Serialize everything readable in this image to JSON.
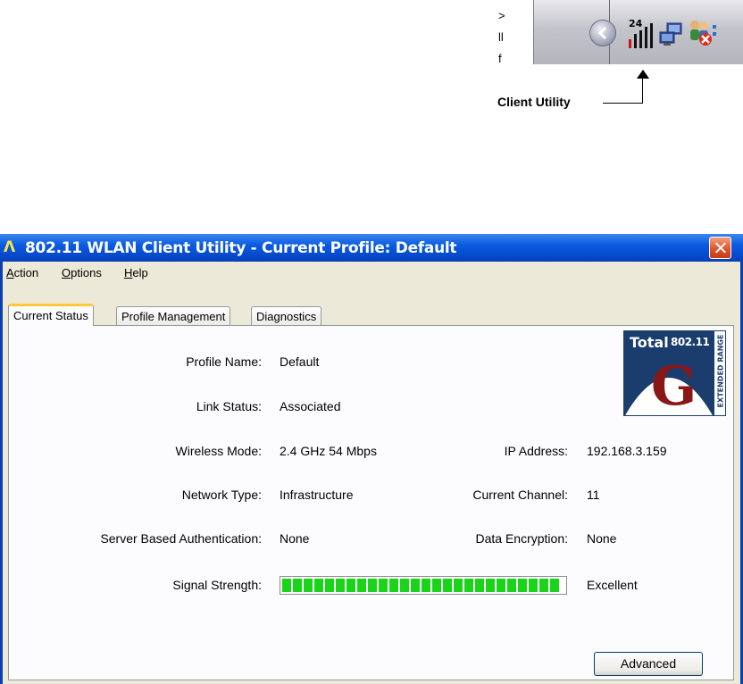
{
  "tray": {
    "left_glyphs": [
      ">",
      "ll",
      "f"
    ],
    "icons": [
      "chevron-left-icon",
      "signal-bars-icon",
      "network-computers-icon",
      "users-disconnected-icon"
    ],
    "signal_icon_label": "24",
    "callout_label": "Client Utility"
  },
  "window": {
    "title": "802.11 WLAN Client Utility - Current Profile: Default",
    "title_color": "#0a5be0",
    "menu": [
      {
        "label": "Action",
        "mnemonic": "A"
      },
      {
        "label": "Options",
        "mnemonic": "O"
      },
      {
        "label": "Help",
        "mnemonic": "H"
      }
    ],
    "tabs": [
      "Current Status",
      "Profile Management",
      "Diagnostics"
    ],
    "active_tab": "Current Status"
  },
  "status": {
    "profile_name_label": "Profile Name:",
    "profile_name": "Default",
    "link_status_label": "Link Status:",
    "link_status": "Associated",
    "wireless_mode_label": "Wireless Mode:",
    "wireless_mode": "2.4 GHz 54 Mbps",
    "ip_address_label": "IP Address:",
    "ip_address": "192.168.3.159",
    "network_type_label": "Network Type:",
    "network_type": "Infrastructure",
    "current_channel_label": "Current Channel:",
    "current_channel": "11",
    "server_auth_label": "Server Based Authentication:",
    "server_auth": "None",
    "data_encryption_label": "Data Encryption:",
    "data_encryption": "None",
    "signal_strength_label": "Signal Strength:",
    "signal_strength_percent": 100,
    "signal_strength_text": "Excellent",
    "signal_color": "#1ad41a",
    "advanced_button": "Advanced"
  },
  "logo": {
    "total": "Total",
    "standard": "802.11",
    "letter": "G",
    "side_text": "EXTENDED RANGE"
  }
}
